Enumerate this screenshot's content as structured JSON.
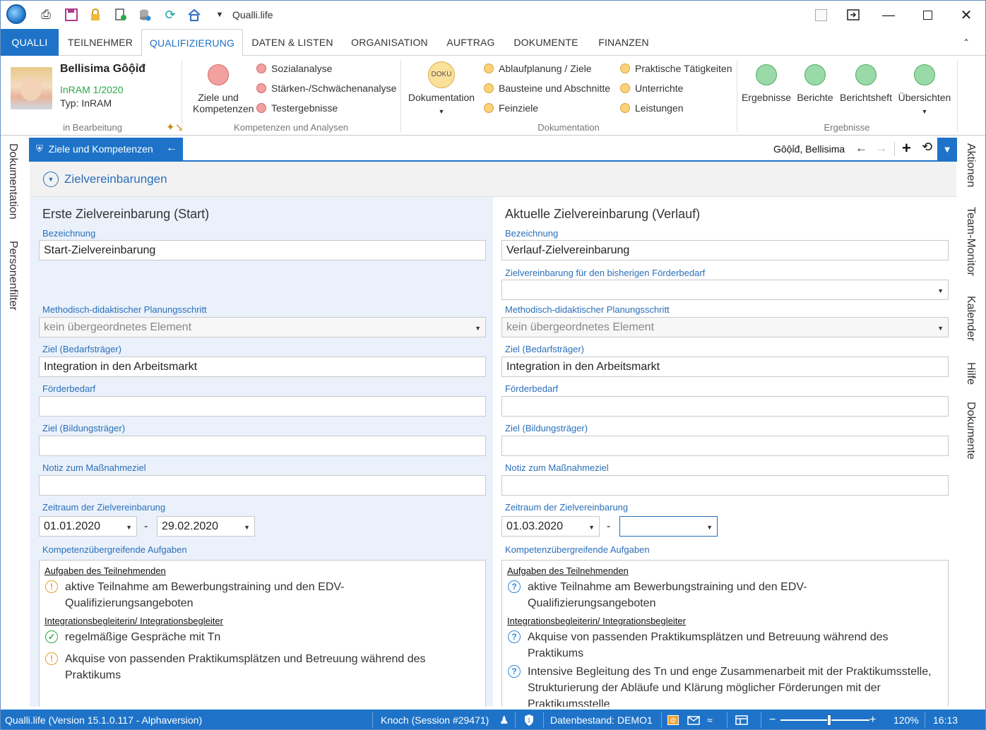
{
  "app": {
    "title": "Qualli.life",
    "accent_color": "#1e73c8",
    "quick_access": [
      "print-icon",
      "save-icon",
      "lock-icon",
      "export-icon",
      "database-icon",
      "refresh-icon",
      "home-icon",
      "dropdown-icon"
    ]
  },
  "tabs": [
    "QUALLI",
    "TEILNEHMER",
    "QUALIFIZIERUNG",
    "DATEN & LISTEN",
    "ORGANISATION",
    "AUFTRAG",
    "DOKUMENTE",
    "FINANZEN"
  ],
  "active_tab": "QUALIFIZIERUNG",
  "participant": {
    "name": "Bellisima Gôộỉđ",
    "program": "InRAM 1/2020",
    "type": "Typ: InRAM",
    "status": "in Bearbeitung"
  },
  "ribbon": {
    "kompetenzen": {
      "label": "Kompetenzen und Analysen",
      "big": "Ziele und Kompetenzen",
      "items": [
        "Sozialanalyse",
        "Stärken-/Schwächenanalyse",
        "Testergebnisse"
      ]
    },
    "dokumentation": {
      "label": "Dokumentation",
      "big": "Dokumentation",
      "badge": "DOKU",
      "col1": [
        "Ablaufplanung / Ziele",
        "Bausteine und Abschnitte",
        "Feinziele"
      ],
      "col2": [
        "Praktische Tätigkeiten",
        "Unterrichte",
        "Leistungen"
      ]
    },
    "ergebnisse": {
      "label": "Ergebnisse",
      "items": [
        "Ergebnisse",
        "Berichte",
        "Berichtsheft",
        "Übersichten"
      ]
    }
  },
  "left_sidebar": [
    "Dokumentation",
    "Personenfilter"
  ],
  "right_sidebar": [
    "Aktionen",
    "Team-Monitor",
    "Kalender",
    "Hilfe",
    "Dokumente"
  ],
  "doc_tab": {
    "title": "Ziele und Kompetenzen",
    "person": "Gôộỉđ, Bellisima"
  },
  "section": {
    "title": "Zielvereinbarungen"
  },
  "left_panel": {
    "title": "Erste Zielvereinbarung (Start)",
    "bezeichnung_label": "Bezeichnung",
    "bezeichnung": "Start-Zielvereinbarung",
    "planung_label": "Methodisch-didaktischer Planungsschritt",
    "planung": "kein übergeordnetes Element",
    "ziel_bedarf_label": "Ziel (Bedarfsträger)",
    "ziel_bedarf": "Integration in den Arbeitsmarkt",
    "foerder_label": "Förderbedarf",
    "foerder": "",
    "ziel_bildung_label": "Ziel (Bildungsträger)",
    "ziel_bildung": "",
    "notiz_label": "Notiz zum Maßnahmeziel",
    "notiz": "",
    "zeitraum_label": "Zeitraum der Zielvereinbarung",
    "von": "01.01.2020",
    "bis": "29.02.2020",
    "dash": "-",
    "aufgaben_label": "Kompetenzübergreifende Aufgaben",
    "group1": "Aufgaben des Teilnehmenden",
    "task1": "aktive Teilnahme am Bewerbungstraining und den EDV-Qualifizierungsangeboten",
    "group2": "Integrationsbegleiterin/ Integrationsbegleiter",
    "task2": "regelmäßige Gespräche mit Tn",
    "task3": "Akquise von passenden Praktikumsplätzen und Betreuung während des Praktikums"
  },
  "right_panel": {
    "title": "Aktuelle Zielvereinbarung (Verlauf)",
    "bezeichnung_label": "Bezeichnung",
    "bezeichnung": "Verlauf-Zielvereinbarung",
    "bisher_label": "Zielvereinbarung für den bisherigen Förderbedarf",
    "bisher": "",
    "planung_label": "Methodisch-didaktischer Planungsschritt",
    "planung": "kein übergeordnetes Element",
    "ziel_bedarf_label": "Ziel (Bedarfsträger)",
    "ziel_bedarf": "Integration in den Arbeitsmarkt",
    "foerder_label": "Förderbedarf",
    "foerder": "",
    "ziel_bildung_label": "Ziel (Bildungsträger)",
    "ziel_bildung": "",
    "notiz_label": "Notiz zum Maßnahmeziel",
    "notiz": "",
    "zeitraum_label": "Zeitraum der Zielvereinbarung",
    "von": "01.03.2020",
    "bis": "",
    "dash": "-",
    "aufgaben_label": "Kompetenzübergreifende Aufgaben",
    "group1": "Aufgaben des Teilnehmenden",
    "task1": "aktive Teilnahme am Bewerbungstraining und den EDV-Qualifizierungsangeboten",
    "group2": "Integrationsbegleiterin/ Integrationsbegleiter",
    "task2": "Akquise von passenden Praktikumsplätzen und Betreuung während des Praktikums",
    "task3": "Intensive Begleitung des Tn und enge Zusammenarbeit mit der Praktikumsstelle, Strukturierung der Abläufe und Klärung möglicher Förderungen mit der Praktikumsstelle"
  },
  "statusbar": {
    "version": "Qualli.life (Version 15.1.0.117 - Alphaversion)",
    "session": "Knoch (Session #29471)",
    "datenbestand": "Datenbestand: DEMO1",
    "zoom": "120%",
    "time": "16:13",
    "zoom_level": 0.55
  }
}
